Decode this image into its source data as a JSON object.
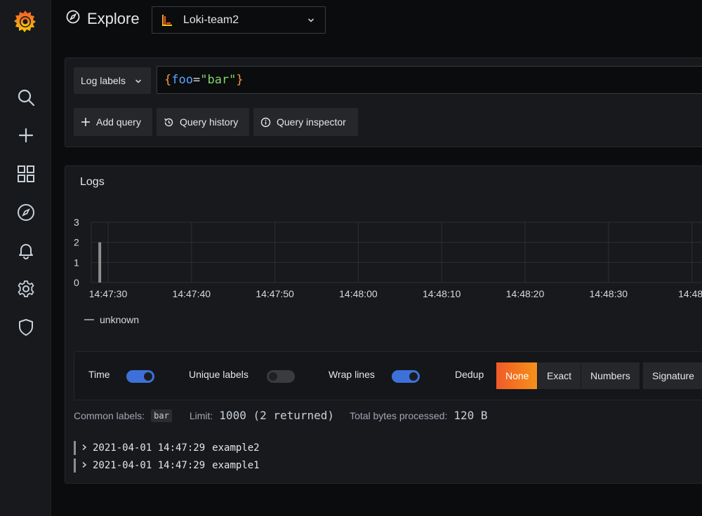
{
  "app": {
    "logo": "grafana-logo",
    "accent": "#f05a28"
  },
  "sidebar": {
    "items": [
      {
        "icon": "search-icon"
      },
      {
        "icon": "plus-icon"
      },
      {
        "icon": "dashboards-icon"
      },
      {
        "icon": "compass-icon"
      },
      {
        "icon": "bell-icon"
      },
      {
        "icon": "gear-icon"
      },
      {
        "icon": "shield-icon"
      }
    ]
  },
  "header": {
    "title": "Explore",
    "datasource": "Loki-team2"
  },
  "query": {
    "labels_button": "Log labels",
    "expr": {
      "open": "{",
      "key": "foo",
      "eq": "=",
      "value": "\"bar\"",
      "close": "}"
    },
    "buttons": {
      "add": "Add query",
      "history": "Query history",
      "inspector": "Query inspector"
    }
  },
  "logs": {
    "title": "Logs",
    "legend": "unknown",
    "options": {
      "time_label": "Time",
      "time_on": true,
      "unique_label": "Unique labels",
      "unique_on": false,
      "wrap_label": "Wrap lines",
      "wrap_on": true,
      "dedup_label": "Dedup",
      "dedup_options": [
        "None",
        "Exact",
        "Numbers",
        "Signature"
      ],
      "dedup_selected": "None"
    },
    "meta": {
      "common_labels_label": "Common labels:",
      "common_labels_value": "bar",
      "limit_label": "Limit:",
      "limit_value": "1000 (2 returned)",
      "bytes_label": "Total bytes processed:",
      "bytes_value": "120 B"
    },
    "rows": [
      {
        "timestamp": "2021-04-01 14:47:29",
        "line": "example2"
      },
      {
        "timestamp": "2021-04-01 14:47:29",
        "line": "example1"
      }
    ]
  },
  "chart_data": {
    "type": "bar",
    "x": [
      "14:47:30",
      "14:47:40",
      "14:47:50",
      "14:48:00",
      "14:48:10",
      "14:48:20",
      "14:48:30",
      "14:48:"
    ],
    "series": [
      {
        "name": "unknown",
        "points": [
          {
            "x": "14:47:29",
            "y": 2
          }
        ]
      }
    ],
    "y_ticks": [
      "0",
      "1",
      "2",
      "3"
    ],
    "ylim": [
      0,
      3
    ],
    "grid": true,
    "legend": "bottom-left",
    "bar_color": "#8e8e8e"
  }
}
